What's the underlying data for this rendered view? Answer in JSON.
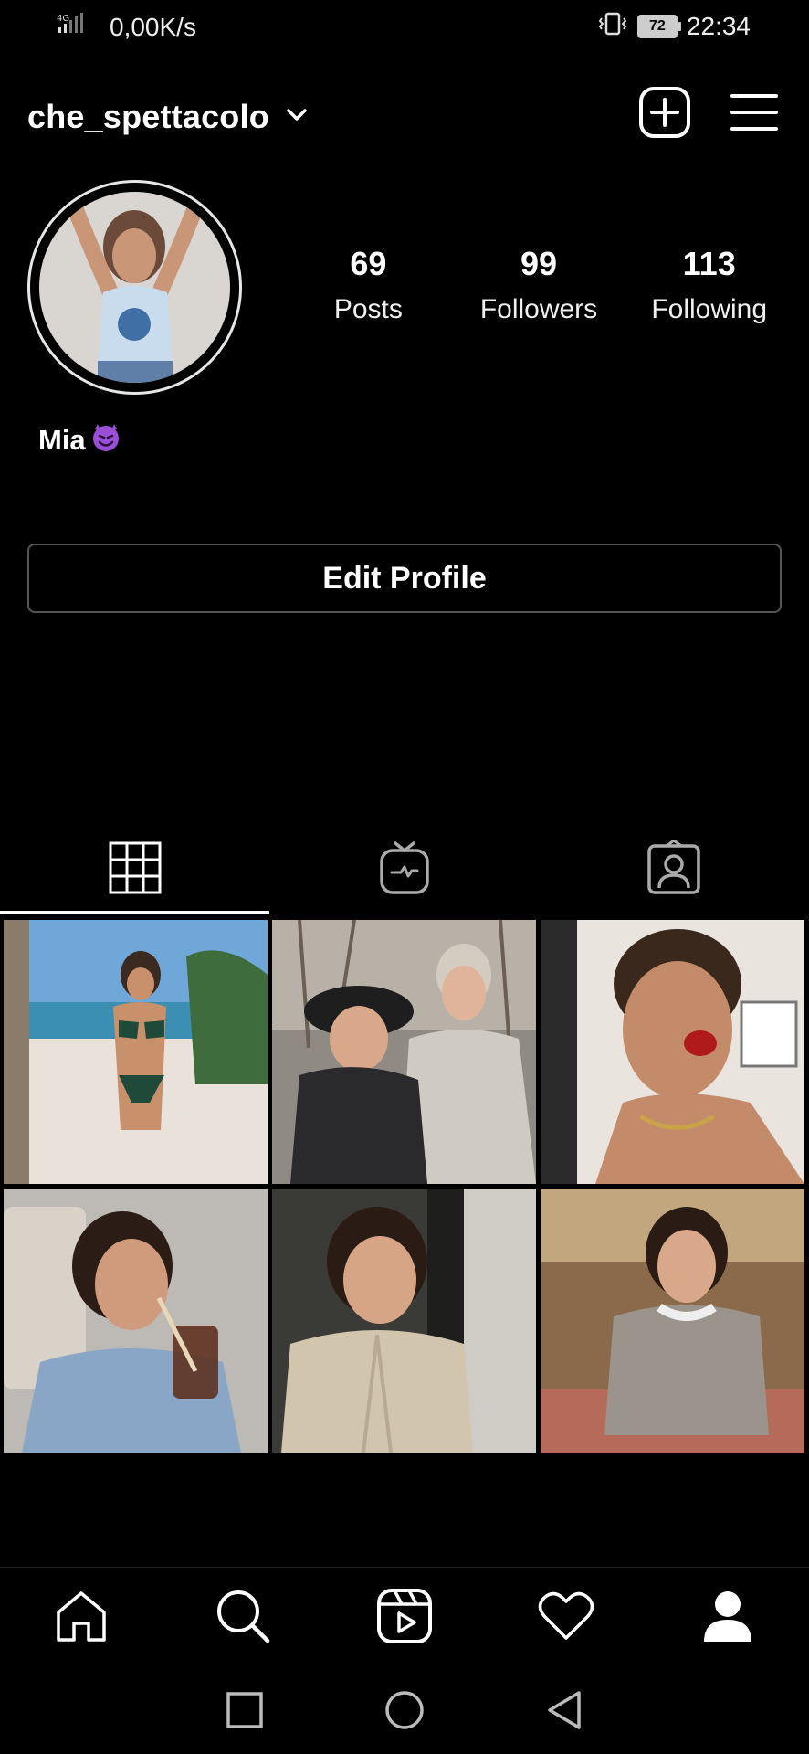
{
  "status_bar": {
    "network": "4G",
    "speed": "0,00K/s",
    "battery": "72",
    "time": "22:34"
  },
  "header": {
    "username": "che_spettacolo"
  },
  "profile": {
    "full_name": "Mia",
    "stats": [
      {
        "value": "69",
        "label": "Posts"
      },
      {
        "value": "99",
        "label": "Followers"
      },
      {
        "value": "113",
        "label": "Following"
      }
    ],
    "edit_label": "Edit Profile"
  },
  "tabs": [
    "grid-icon",
    "igtv-icon",
    "tagged-icon"
  ],
  "posts": [
    {
      "name": "post-beach-bikini"
    },
    {
      "name": "post-couple-winter"
    },
    {
      "name": "post-strawberry"
    },
    {
      "name": "post-car-drink"
    },
    {
      "name": "post-trench-coat"
    },
    {
      "name": "post-robe-chair"
    }
  ],
  "nav": [
    "home-icon",
    "search-icon",
    "reels-icon",
    "activity-heart-icon",
    "profile-icon"
  ],
  "colors": {
    "background": "#000000",
    "text": "#ffffff",
    "border": "#555555"
  }
}
